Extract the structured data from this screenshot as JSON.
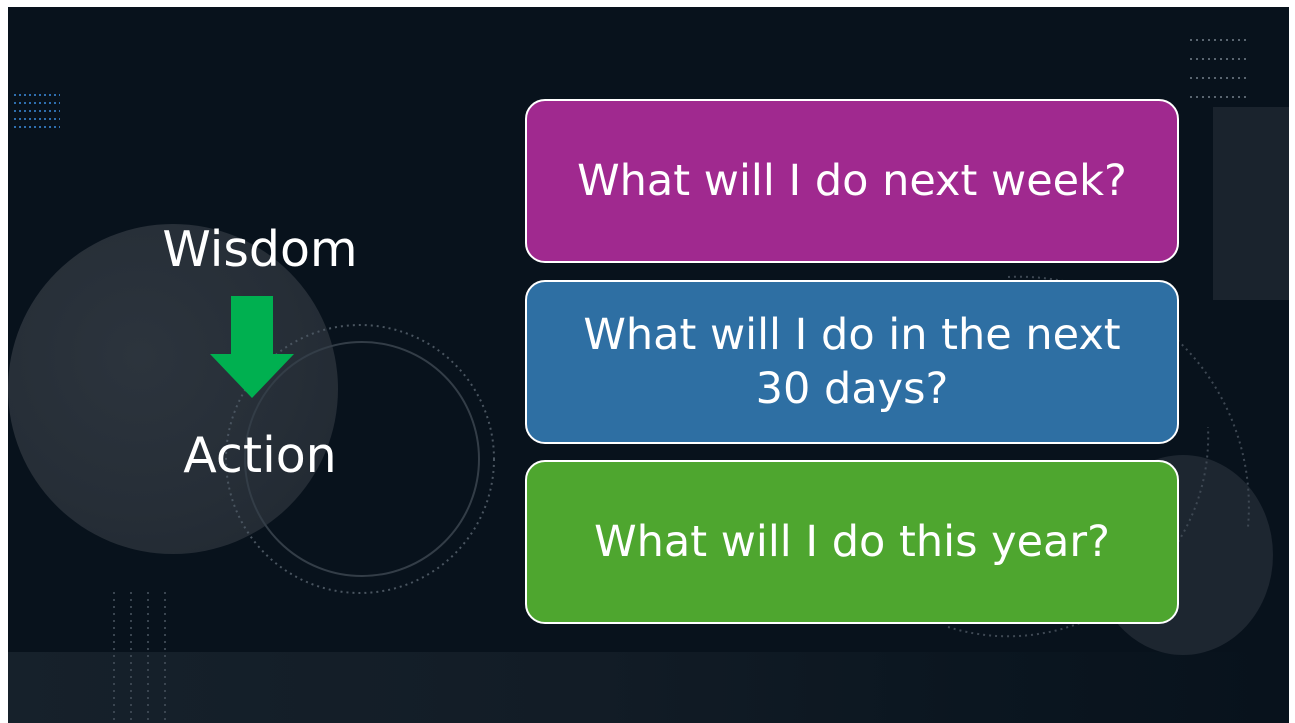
{
  "flow": {
    "top_label": "Wisdom",
    "bottom_label": "Action",
    "arrow_icon": "down-arrow-icon",
    "arrow_color": "#00b050"
  },
  "questions": [
    {
      "text": "What will I do next week?",
      "color": "#a0298f"
    },
    {
      "text": "What will I do in the next 30 days?",
      "color": "#2e6fa3"
    },
    {
      "text": "What will I do this year?",
      "color": "#4ea62f"
    }
  ],
  "theme": {
    "background": "#08121c",
    "border": "#ffffff"
  }
}
